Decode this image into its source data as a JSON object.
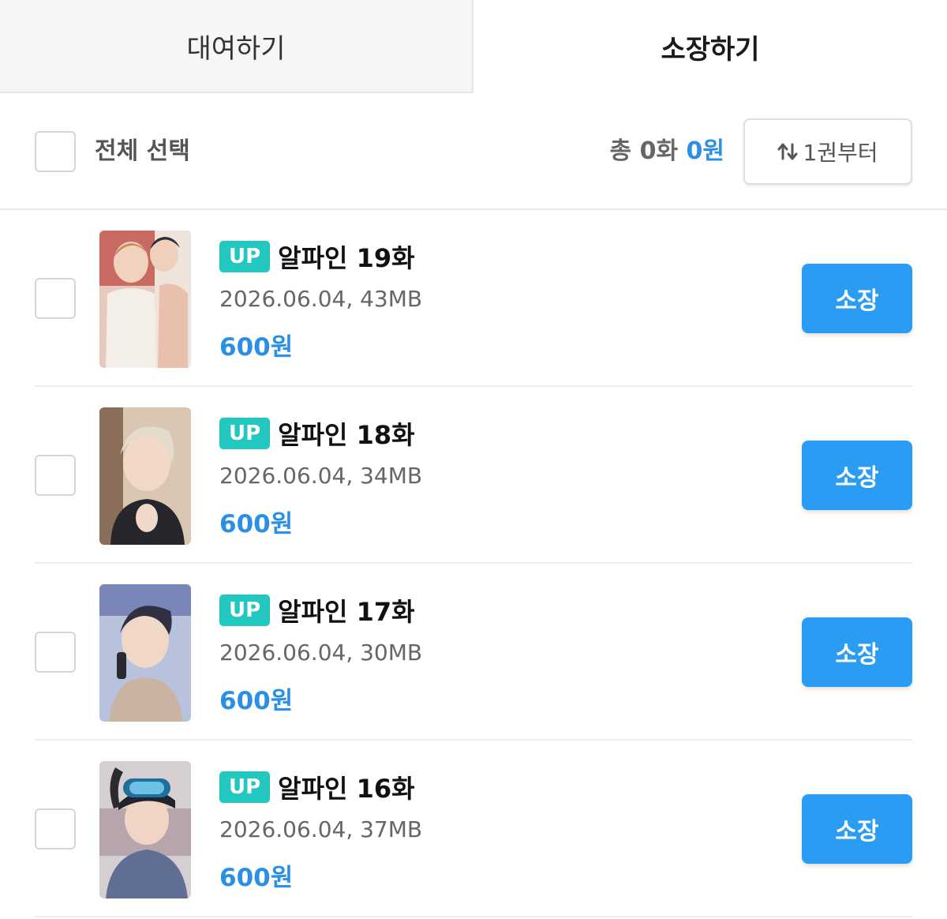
{
  "tabs": [
    {
      "label": "대여하기",
      "active": false
    },
    {
      "label": "소장하기",
      "active": true
    }
  ],
  "toolbar": {
    "select_all_label": "전체 선택",
    "total_prefix": "총 0화",
    "total_amount": "0원",
    "sort_label": "1권부터",
    "sort_icon": "sort-arrows-icon"
  },
  "episodes": [
    {
      "badge": "UP",
      "title": "알파인 19화",
      "meta": "2026.06.04, 43MB",
      "price": "600원",
      "button": "소장"
    },
    {
      "badge": "UP",
      "title": "알파인 18화",
      "meta": "2026.06.04, 34MB",
      "price": "600원",
      "button": "소장"
    },
    {
      "badge": "UP",
      "title": "알파인 17화",
      "meta": "2026.06.04, 30MB",
      "price": "600원",
      "button": "소장"
    },
    {
      "badge": "UP",
      "title": "알파인 16화",
      "meta": "2026.06.04, 37MB",
      "price": "600원",
      "button": "소장"
    }
  ],
  "colors": {
    "accent_blue": "#2b9cf4",
    "price_blue": "#2a8fe6",
    "badge_teal": "#22c7bf"
  }
}
